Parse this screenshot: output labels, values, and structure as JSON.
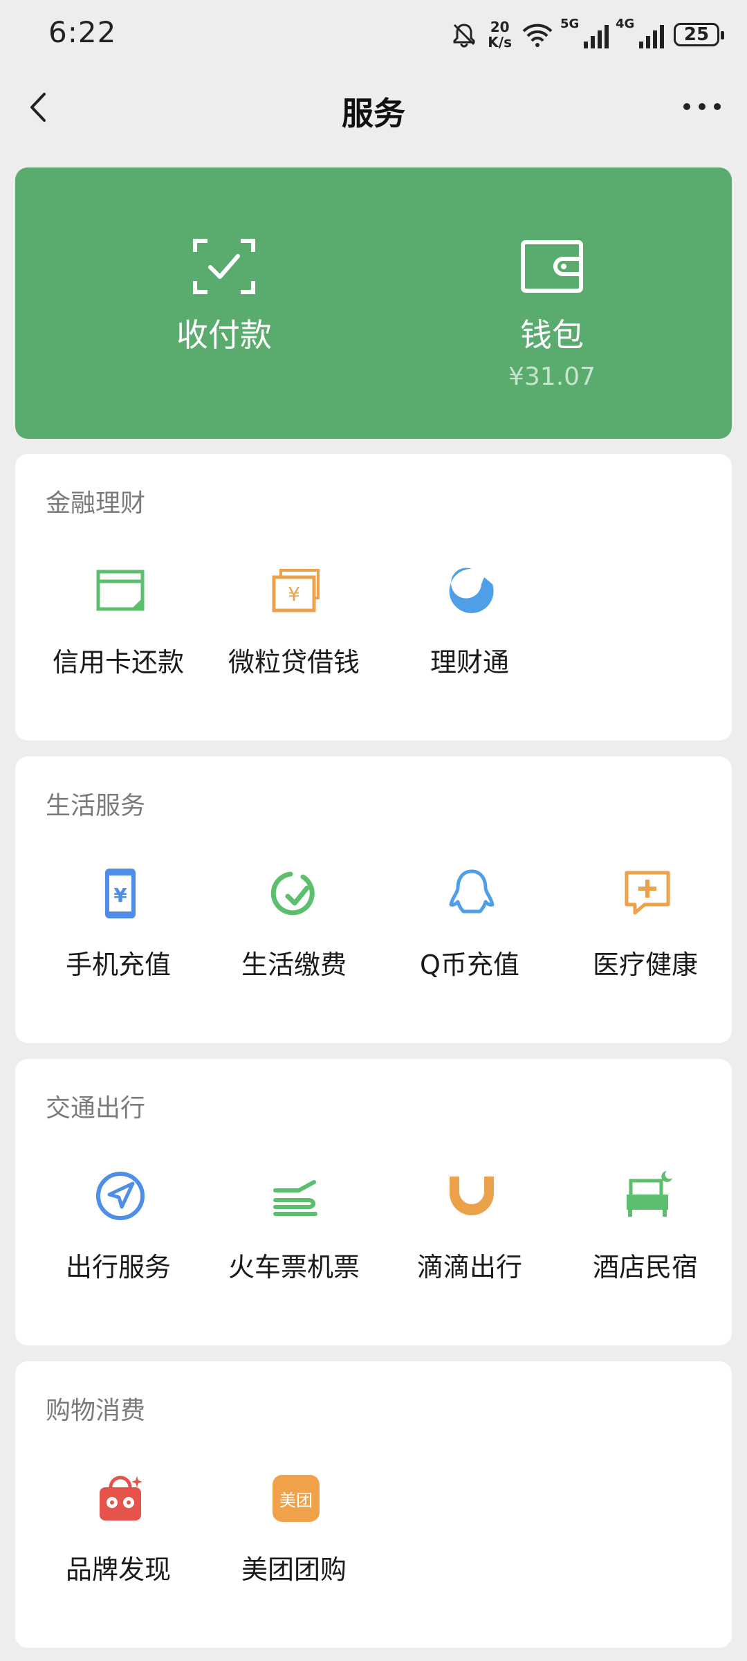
{
  "status": {
    "time": "6:22",
    "speed_value": "20",
    "speed_unit": "K/s",
    "net1": "5G",
    "net2": "4G",
    "battery": "25"
  },
  "nav": {
    "title": "服务"
  },
  "top_card": {
    "pay_label": "收付款",
    "wallet_label": "钱包",
    "wallet_balance": "¥31.07"
  },
  "sections": [
    {
      "title": "金融理财",
      "items": [
        {
          "label": "信用卡还款",
          "icon": "credit-card-icon"
        },
        {
          "label": "微粒贷借钱",
          "icon": "loan-icon"
        },
        {
          "label": "理财通",
          "icon": "wealth-icon"
        }
      ]
    },
    {
      "title": "生活服务",
      "items": [
        {
          "label": "手机充值",
          "icon": "phone-recharge-icon"
        },
        {
          "label": "生活缴费",
          "icon": "utility-payment-icon"
        },
        {
          "label": "Q币充值",
          "icon": "qq-coin-icon"
        },
        {
          "label": "医疗健康",
          "icon": "medical-icon"
        }
      ]
    },
    {
      "title": "交通出行",
      "items": [
        {
          "label": "出行服务",
          "icon": "travel-icon"
        },
        {
          "label": "火车票机票",
          "icon": "train-plane-icon"
        },
        {
          "label": "滴滴出行",
          "icon": "didi-icon"
        },
        {
          "label": "酒店民宿",
          "icon": "hotel-icon"
        }
      ]
    },
    {
      "title": "购物消费",
      "items": [
        {
          "label": "品牌发现",
          "icon": "brand-bag-icon"
        },
        {
          "label": "美团团购",
          "icon": "meituan-icon",
          "icon_text": "美团"
        }
      ]
    }
  ],
  "colors": {
    "green_card": "#5aac6e",
    "icon_green": "#5cbf6e",
    "icon_orange": "#eba24b",
    "icon_blue": "#4f8ee8",
    "icon_red": "#e5534b"
  }
}
